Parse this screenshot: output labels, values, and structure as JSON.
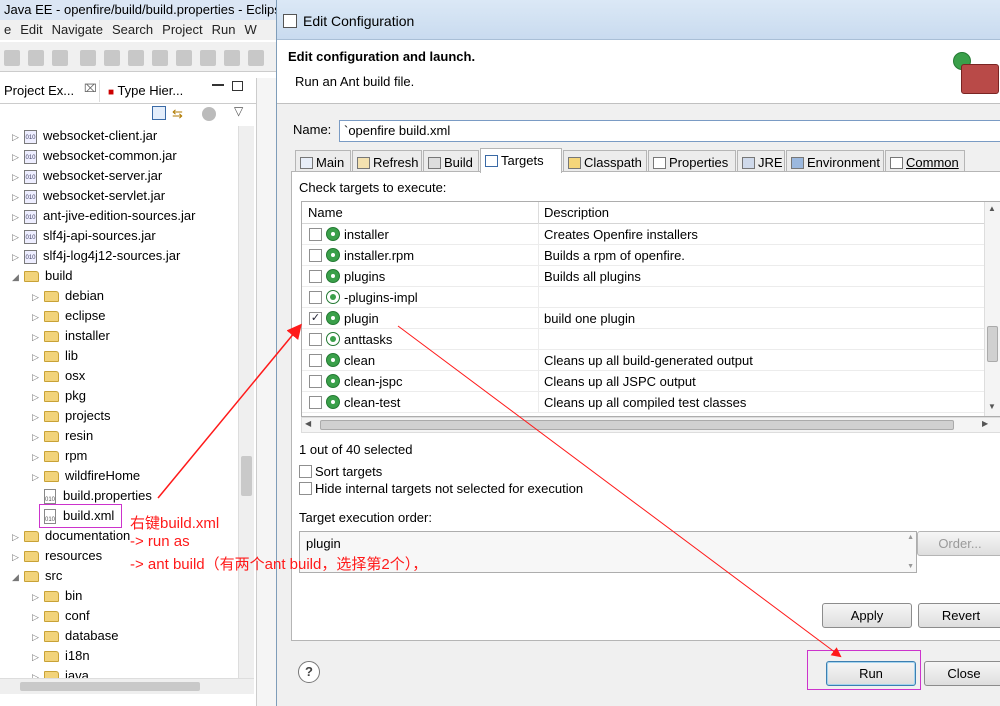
{
  "eclipse": {
    "title": "Java EE - openfire/build/build.properties - Eclipse",
    "menu": [
      "e",
      "Edit",
      "Navigate",
      "Search",
      "Project",
      "Run",
      "W"
    ],
    "view_tabs": [
      "Project Ex...",
      "Type Hier..."
    ],
    "tree": [
      {
        "label": "websocket-client.jar",
        "type": "jar",
        "indent": 1
      },
      {
        "label": "websocket-common.jar",
        "type": "jar",
        "indent": 1
      },
      {
        "label": "websocket-server.jar",
        "type": "jar",
        "indent": 1
      },
      {
        "label": "websocket-servlet.jar",
        "type": "jar",
        "indent": 1
      },
      {
        "label": "ant-jive-edition-sources.jar",
        "type": "jar",
        "indent": 1
      },
      {
        "label": "slf4j-api-sources.jar",
        "type": "jar",
        "indent": 1
      },
      {
        "label": "slf4j-log4j12-sources.jar",
        "type": "jar",
        "indent": 1
      },
      {
        "label": "build",
        "type": "folder-open",
        "indent": 1
      },
      {
        "label": "debian",
        "type": "folder",
        "indent": 2
      },
      {
        "label": "eclipse",
        "type": "folder",
        "indent": 2
      },
      {
        "label": "installer",
        "type": "folder",
        "indent": 2
      },
      {
        "label": "lib",
        "type": "folder",
        "indent": 2
      },
      {
        "label": "osx",
        "type": "folder",
        "indent": 2
      },
      {
        "label": "pkg",
        "type": "folder",
        "indent": 2
      },
      {
        "label": "projects",
        "type": "folder",
        "indent": 2
      },
      {
        "label": "resin",
        "type": "folder",
        "indent": 2
      },
      {
        "label": "rpm",
        "type": "folder",
        "indent": 2
      },
      {
        "label": "wildfireHome",
        "type": "folder",
        "indent": 2
      },
      {
        "label": "build.properties",
        "type": "file",
        "indent": 2
      },
      {
        "label": "build.xml",
        "type": "file",
        "indent": 2
      },
      {
        "label": "documentation",
        "type": "folder",
        "indent": 1
      },
      {
        "label": "resources",
        "type": "folder",
        "indent": 1
      },
      {
        "label": "src",
        "type": "folder-open",
        "indent": 1
      },
      {
        "label": "bin",
        "type": "folder",
        "indent": 2
      },
      {
        "label": "conf",
        "type": "folder",
        "indent": 2
      },
      {
        "label": "database",
        "type": "folder",
        "indent": 2
      },
      {
        "label": "i18n",
        "type": "folder",
        "indent": 2
      },
      {
        "label": "java",
        "type": "folder",
        "indent": 2
      }
    ]
  },
  "dialog": {
    "title": "Edit Configuration",
    "header_title": "Edit configuration and launch.",
    "header_sub": "Run an Ant build file.",
    "name_label": "Name:",
    "name_value": "`openfire build.xml",
    "tabs": [
      "Main",
      "Refresh",
      "Build",
      "Targets",
      "Classpath",
      "Properties",
      "JRE",
      "Environment",
      "Common"
    ],
    "check_label": "Check targets to execute:",
    "col_name": "Name",
    "col_desc": "Description",
    "targets": [
      {
        "name": "installer",
        "desc": "Creates Openfire installers",
        "checked": false,
        "internal": false
      },
      {
        "name": "installer.rpm",
        "desc": "Builds a rpm of openfire.",
        "checked": false,
        "internal": false
      },
      {
        "name": "plugins",
        "desc": "Builds all plugins",
        "checked": false,
        "internal": false
      },
      {
        "name": "-plugins-impl",
        "desc": "",
        "checked": false,
        "internal": true
      },
      {
        "name": "plugin",
        "desc": "build one plugin",
        "checked": true,
        "internal": false
      },
      {
        "name": "anttasks",
        "desc": "",
        "checked": false,
        "internal": true
      },
      {
        "name": "clean",
        "desc": "Cleans up all build-generated output",
        "checked": false,
        "internal": false
      },
      {
        "name": "clean-jspc",
        "desc": "Cleans up all JSPC output",
        "checked": false,
        "internal": false
      },
      {
        "name": "clean-test",
        "desc": "Cleans up all compiled test classes",
        "checked": false,
        "internal": false
      }
    ],
    "selected_count": "1 out of 40 selected",
    "sort_label": "Sort targets",
    "hide_label": "Hide internal targets not selected for execution",
    "order_label": "Target execution order:",
    "order_value": "plugin",
    "order_button": "Order...",
    "apply_button": "Apply",
    "revert_button": "Revert",
    "run_button": "Run",
    "close_button": "Close",
    "help_glyph": "?"
  },
  "annotation": {
    "line1": "右键build.xml",
    "line2": "-> run as",
    "line3": "-> ant build（有两个ant build，选择第2个），"
  }
}
